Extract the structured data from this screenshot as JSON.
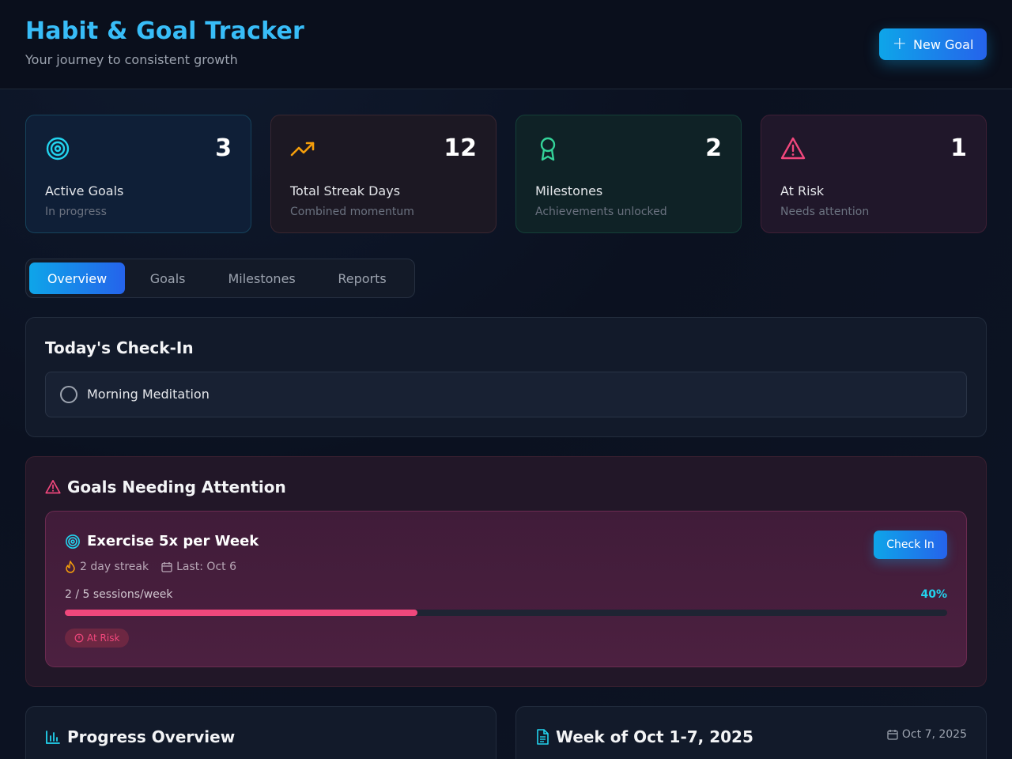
{
  "header": {
    "title": "Habit & Goal Tracker",
    "subtitle": "Your journey to consistent growth",
    "new_goal_label": "New Goal"
  },
  "stats": [
    {
      "icon": "target-icon",
      "value": "3",
      "label": "Active Goals",
      "sub": "In progress",
      "color": "#22d3ee"
    },
    {
      "icon": "trending-up-icon",
      "value": "12",
      "label": "Total Streak Days",
      "sub": "Combined momentum",
      "color": "#f59e0b"
    },
    {
      "icon": "award-icon",
      "value": "2",
      "label": "Milestones",
      "sub": "Achievements unlocked",
      "color": "#34d399"
    },
    {
      "icon": "alert-triangle-icon",
      "value": "1",
      "label": "At Risk",
      "sub": "Needs attention",
      "color": "#f0477c"
    }
  ],
  "tabs": [
    {
      "label": "Overview",
      "active": true
    },
    {
      "label": "Goals",
      "active": false
    },
    {
      "label": "Milestones",
      "active": false
    },
    {
      "label": "Reports",
      "active": false
    }
  ],
  "checkin": {
    "title": "Today's Check-In",
    "habits": [
      {
        "name": "Morning Meditation",
        "done": false
      }
    ]
  },
  "attention": {
    "title": "Goals Needing Attention",
    "goal": {
      "name": "Exercise 5x per Week",
      "streak": "2 day streak",
      "last": "Last: Oct 6",
      "checkin_label": "Check In",
      "progress_label": "2 / 5 sessions/week",
      "progress_pct_label": "40%",
      "progress_value": 0.4,
      "status": "At Risk"
    }
  },
  "progress_overview": {
    "title": "Progress Overview"
  },
  "weekly_report": {
    "title": "Week of Oct 1-7, 2025",
    "date": "Oct 7, 2025"
  },
  "colors": {
    "accent": "#0ea5e9",
    "accent_end": "#2563eb",
    "risk": "#f0477c",
    "success": "#34d399",
    "warning": "#f59e0b"
  }
}
